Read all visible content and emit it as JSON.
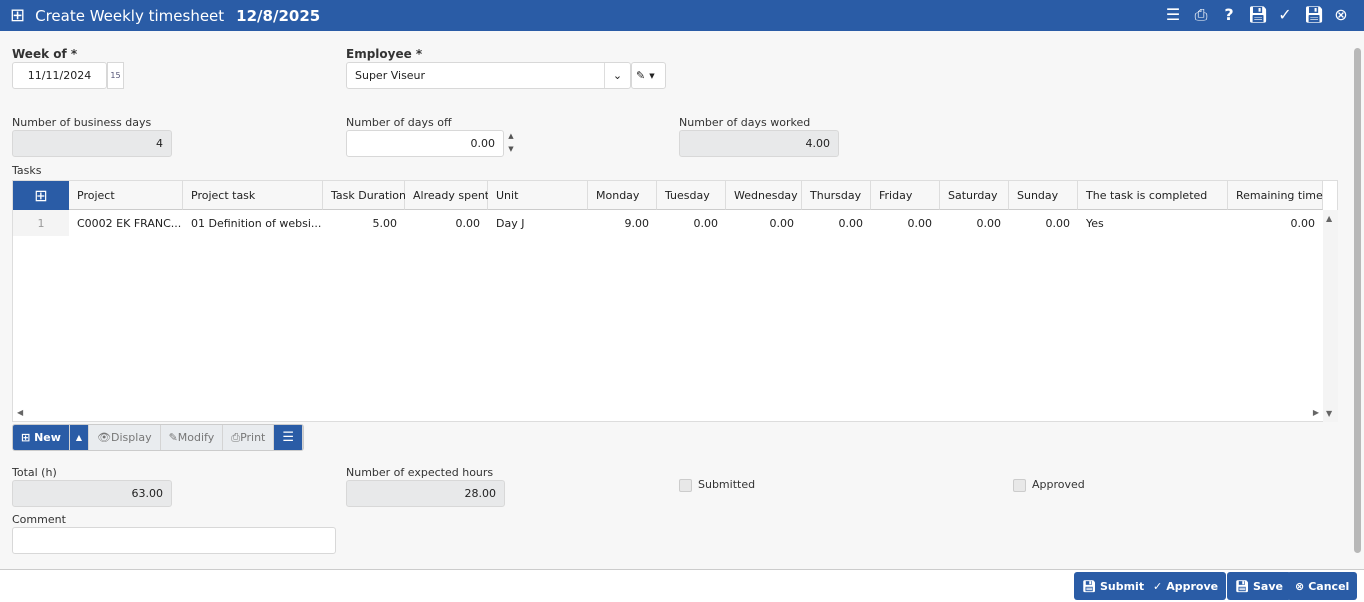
{
  "header": {
    "title": "Create Weekly timesheet",
    "date": "12/8/2025"
  },
  "form": {
    "week_of_label": "Week of *",
    "week_of_value": "11/11/2024",
    "calendar_day": "15",
    "employee_label": "Employee *",
    "employee_value": "Super Viseur",
    "business_days_label": "Number of business days",
    "business_days_value": "4",
    "days_off_label": "Number of days off",
    "days_off_value": "0.00",
    "days_worked_label": "Number of days worked",
    "days_worked_value": "4.00",
    "tasks_label": "Tasks",
    "total_label": "Total (h)",
    "total_value": "63.00",
    "expected_label": "Number of expected hours",
    "expected_value": "28.00",
    "submitted_label": "Submitted",
    "approved_label": "Approved",
    "comment_label": "Comment",
    "comment_value": ""
  },
  "grid": {
    "columns": [
      "Project",
      "Project task",
      "Task Duration",
      "Already spent",
      "Unit",
      "Monday",
      "Tuesday",
      "Wednesday",
      "Thursday",
      "Friday",
      "Saturday",
      "Sunday",
      "The task is completed",
      "Remaining time"
    ],
    "rows": [
      [
        "1",
        "C0002 EK FRANC...",
        "01 Definition of websi...",
        "5.00",
        "0.00",
        "Day J",
        "9.00",
        "0.00",
        "0.00",
        "0.00",
        "0.00",
        "0.00",
        "0.00",
        "Yes",
        "0.00"
      ]
    ]
  },
  "toolbar": {
    "new": "New",
    "display": "Display",
    "modify": "Modify",
    "print": "Print"
  },
  "footer": {
    "submit": "Submit",
    "approve": "Approve",
    "save": "Save",
    "cancel": "Cancel"
  }
}
